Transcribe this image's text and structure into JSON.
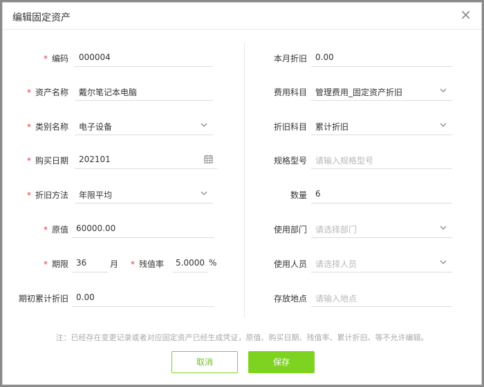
{
  "dialog": {
    "title": "编辑固定资产",
    "close": "×"
  },
  "left": {
    "code": {
      "label": "编码",
      "value": "000004"
    },
    "asset_name": {
      "label": "资产名称",
      "value": "戴尔笔记本电脑"
    },
    "category": {
      "label": "类别名称",
      "value": "电子设备"
    },
    "purchase_date": {
      "label": "购买日期",
      "value": "202101"
    },
    "depr_method": {
      "label": "折旧方法",
      "value": "年限平均"
    },
    "original_value": {
      "label": "原值",
      "value": "60000.00"
    },
    "period": {
      "label": "期限",
      "value": "36",
      "unit": "月"
    },
    "salvage_rate": {
      "label": "残值率",
      "value": "5.0000",
      "unit": "%"
    },
    "opening_accum": {
      "label": "期初累计折旧",
      "value": "0.00"
    }
  },
  "right": {
    "monthly_depr": {
      "label": "本月折旧",
      "value": "0.00"
    },
    "expense_account": {
      "label": "费用科目",
      "value": "管理费用_固定资产折旧"
    },
    "depr_account": {
      "label": "折旧科目",
      "value": "累计折旧"
    },
    "spec": {
      "label": "规格型号",
      "placeholder": "请输入规格型号"
    },
    "quantity": {
      "label": "数量",
      "value": "6"
    },
    "department": {
      "label": "使用部门",
      "placeholder": "请选择部门"
    },
    "user": {
      "label": "使用人员",
      "placeholder": "请选择人员"
    },
    "location": {
      "label": "存放地点",
      "placeholder": "请输入地点"
    }
  },
  "required_mark": "*",
  "note": "注：已经存在变更记录或者对应固定资产已经生成凭证，原值、购买日期、残值率、累计折旧、等不允许编辑。",
  "buttons": {
    "cancel": "取消",
    "save": "保存"
  },
  "colors": {
    "accent": "#7ed321",
    "required": "#e4393c"
  }
}
